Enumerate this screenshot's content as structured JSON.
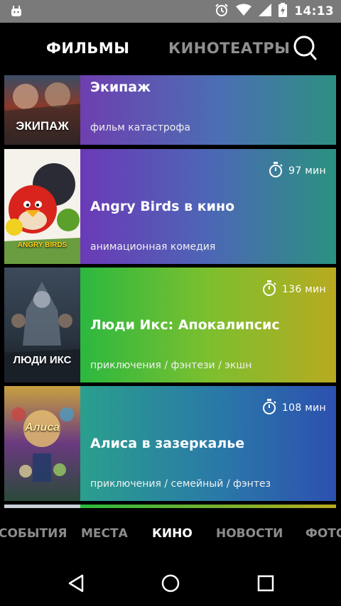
{
  "status_bar": {
    "time": "14:13",
    "icons": [
      "android-icon",
      "alarm-icon",
      "wifi-icon",
      "signal-icon",
      "battery-icon"
    ]
  },
  "top_tabs": {
    "films": "ФИЛЬМЫ",
    "cinemas": "КИНОТЕАТРЫ"
  },
  "movies": [
    {
      "title": "Экипаж",
      "genre": "фильм катастрофа",
      "duration": "",
      "poster_title": "ЭКИПАЖ"
    },
    {
      "title": "Angry Birds в кино",
      "genre": "анимационная комедия",
      "duration": "97  мин",
      "poster_title": "ANGRY BIRDS"
    },
    {
      "title": "Люди Икс: Апокалипсис",
      "genre": "приключения / фэнтези / экшн",
      "duration": "136  мин",
      "poster_title": "ЛЮДИ ИКС"
    },
    {
      "title": "Алиса в зазеркалье",
      "genre": "приключения / семейный / фэнтез",
      "duration": "108  мин",
      "poster_title": "Алиса"
    }
  ],
  "bottom_tabs": [
    "СОБЫТИЯ",
    "МЕСТА",
    "КИНО",
    "НОВОСТИ",
    "ФОТО"
  ],
  "active_bottom_tab": "КИНО",
  "colors": {
    "status_bar": "#7a7a7a",
    "background": "#000000",
    "inactive_text": "#8f8f8f"
  }
}
